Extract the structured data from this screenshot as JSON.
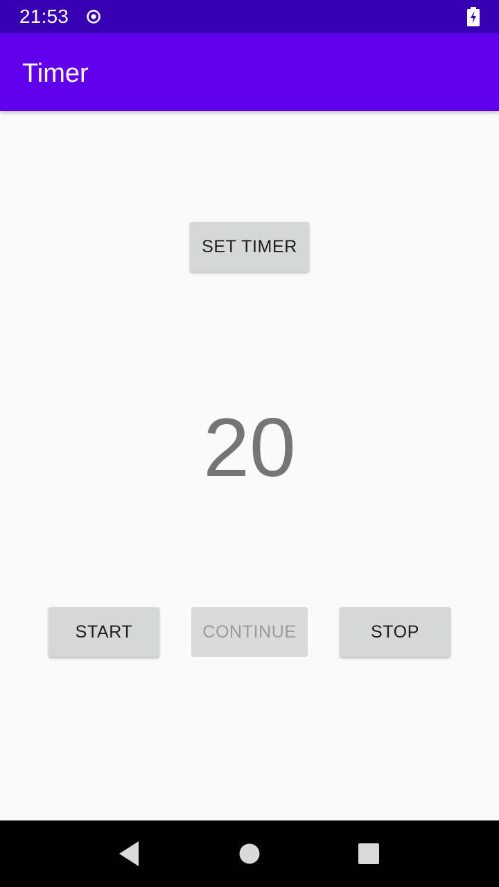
{
  "status_bar": {
    "time": "21:53",
    "icons": [
      "record-icon",
      "battery-charging-icon"
    ]
  },
  "app_bar": {
    "title": "Timer",
    "color": "#6200ee"
  },
  "main": {
    "set_timer_label": "SET TIMER",
    "timer_value": "20",
    "buttons": {
      "start_label": "START",
      "continue_label": "CONTINUE",
      "continue_enabled": false,
      "stop_label": "STOP"
    }
  },
  "nav_bar": {
    "icons": [
      "back-icon",
      "home-icon",
      "recents-icon"
    ]
  },
  "colors": {
    "status_bar": "#3700b3",
    "app_bar": "#6200ee",
    "background": "#fafafa",
    "button": "#d6d7d7",
    "timer_text": "#757575"
  }
}
